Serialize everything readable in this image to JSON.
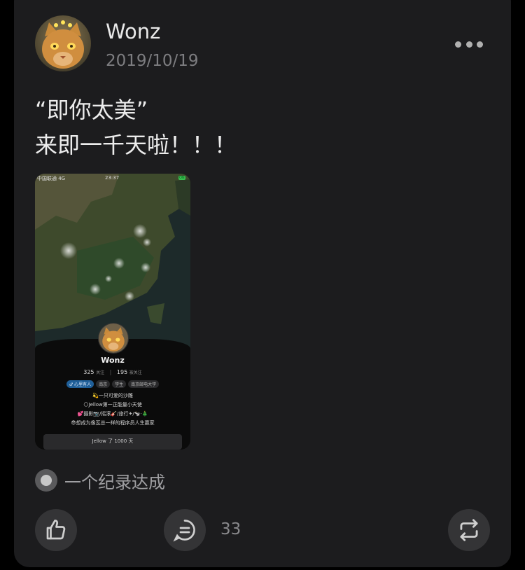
{
  "post": {
    "author": "Wonz",
    "date": "2019/10/19",
    "content": "“即你太美”\n来即一千天啦！！！",
    "topic": "一个纪录达成",
    "comment_count": "33"
  },
  "screenshot": {
    "status_carrier": "中国联通 4G",
    "status_time": "23:37",
    "status_battery": "ON",
    "profile_name": "Wonz",
    "following_count": "325",
    "following_label": "关注",
    "followers_count": "195",
    "followers_label": "被关注",
    "tags": [
      "♂ 心里有人",
      "南京",
      "学生",
      "南京邮电大学"
    ],
    "bio_lines": [
      "💫一只可爱的沙雕",
      "🌕Jellow第一正能量小天使",
      "💕摄影📷/摇滚🎸/旅行✈/🐄·🎄",
      "😎想成为像瓦总一样的程序员人生赢家"
    ],
    "footer_button": "Jellow 了 1000 天"
  },
  "icons": {
    "more": "more-dots-icon",
    "like": "thumbs-up-icon",
    "comment": "comment-bubble-icon",
    "repost": "repost-icon"
  },
  "colors": {
    "card": "#1c1c1e",
    "button": "#343436",
    "tag_blue": "#1f5f99"
  }
}
